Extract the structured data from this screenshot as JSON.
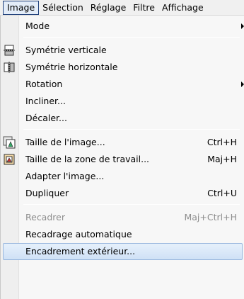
{
  "menubar": {
    "items": [
      "Image",
      "Sélection",
      "Réglage",
      "Filtre",
      "Affichage"
    ]
  },
  "menu": {
    "mode": {
      "label": "Mode"
    },
    "flip_vertical": {
      "label": "Symétrie verticale",
      "icon": "flip-vertical-icon"
    },
    "flip_horizontal": {
      "label": "Symétrie horizontale",
      "icon": "flip-horizontal-icon"
    },
    "rotation": {
      "label": "Rotation"
    },
    "skew": {
      "label": "Incliner..."
    },
    "offset": {
      "label": "Décaler..."
    },
    "image_size": {
      "label": "Taille de l'image...",
      "shortcut": "Ctrl+H",
      "icon": "image-size-icon"
    },
    "canvas_size": {
      "label": "Taille de la zone de travail...",
      "shortcut": "Maj+H",
      "icon": "canvas-size-icon"
    },
    "fit_image": {
      "label": "Adapter l'image..."
    },
    "duplicate": {
      "label": "Dupliquer",
      "shortcut": "Ctrl+U"
    },
    "crop": {
      "label": "Recadrer",
      "shortcut": "Maj+Ctrl+H"
    },
    "auto_crop": {
      "label": "Recadrage automatique"
    },
    "outer_frame": {
      "label": "Encadrement extérieur..."
    }
  },
  "colors": {
    "highlight": "#cfe1f6",
    "disabled_text": "#8d8d8d"
  }
}
